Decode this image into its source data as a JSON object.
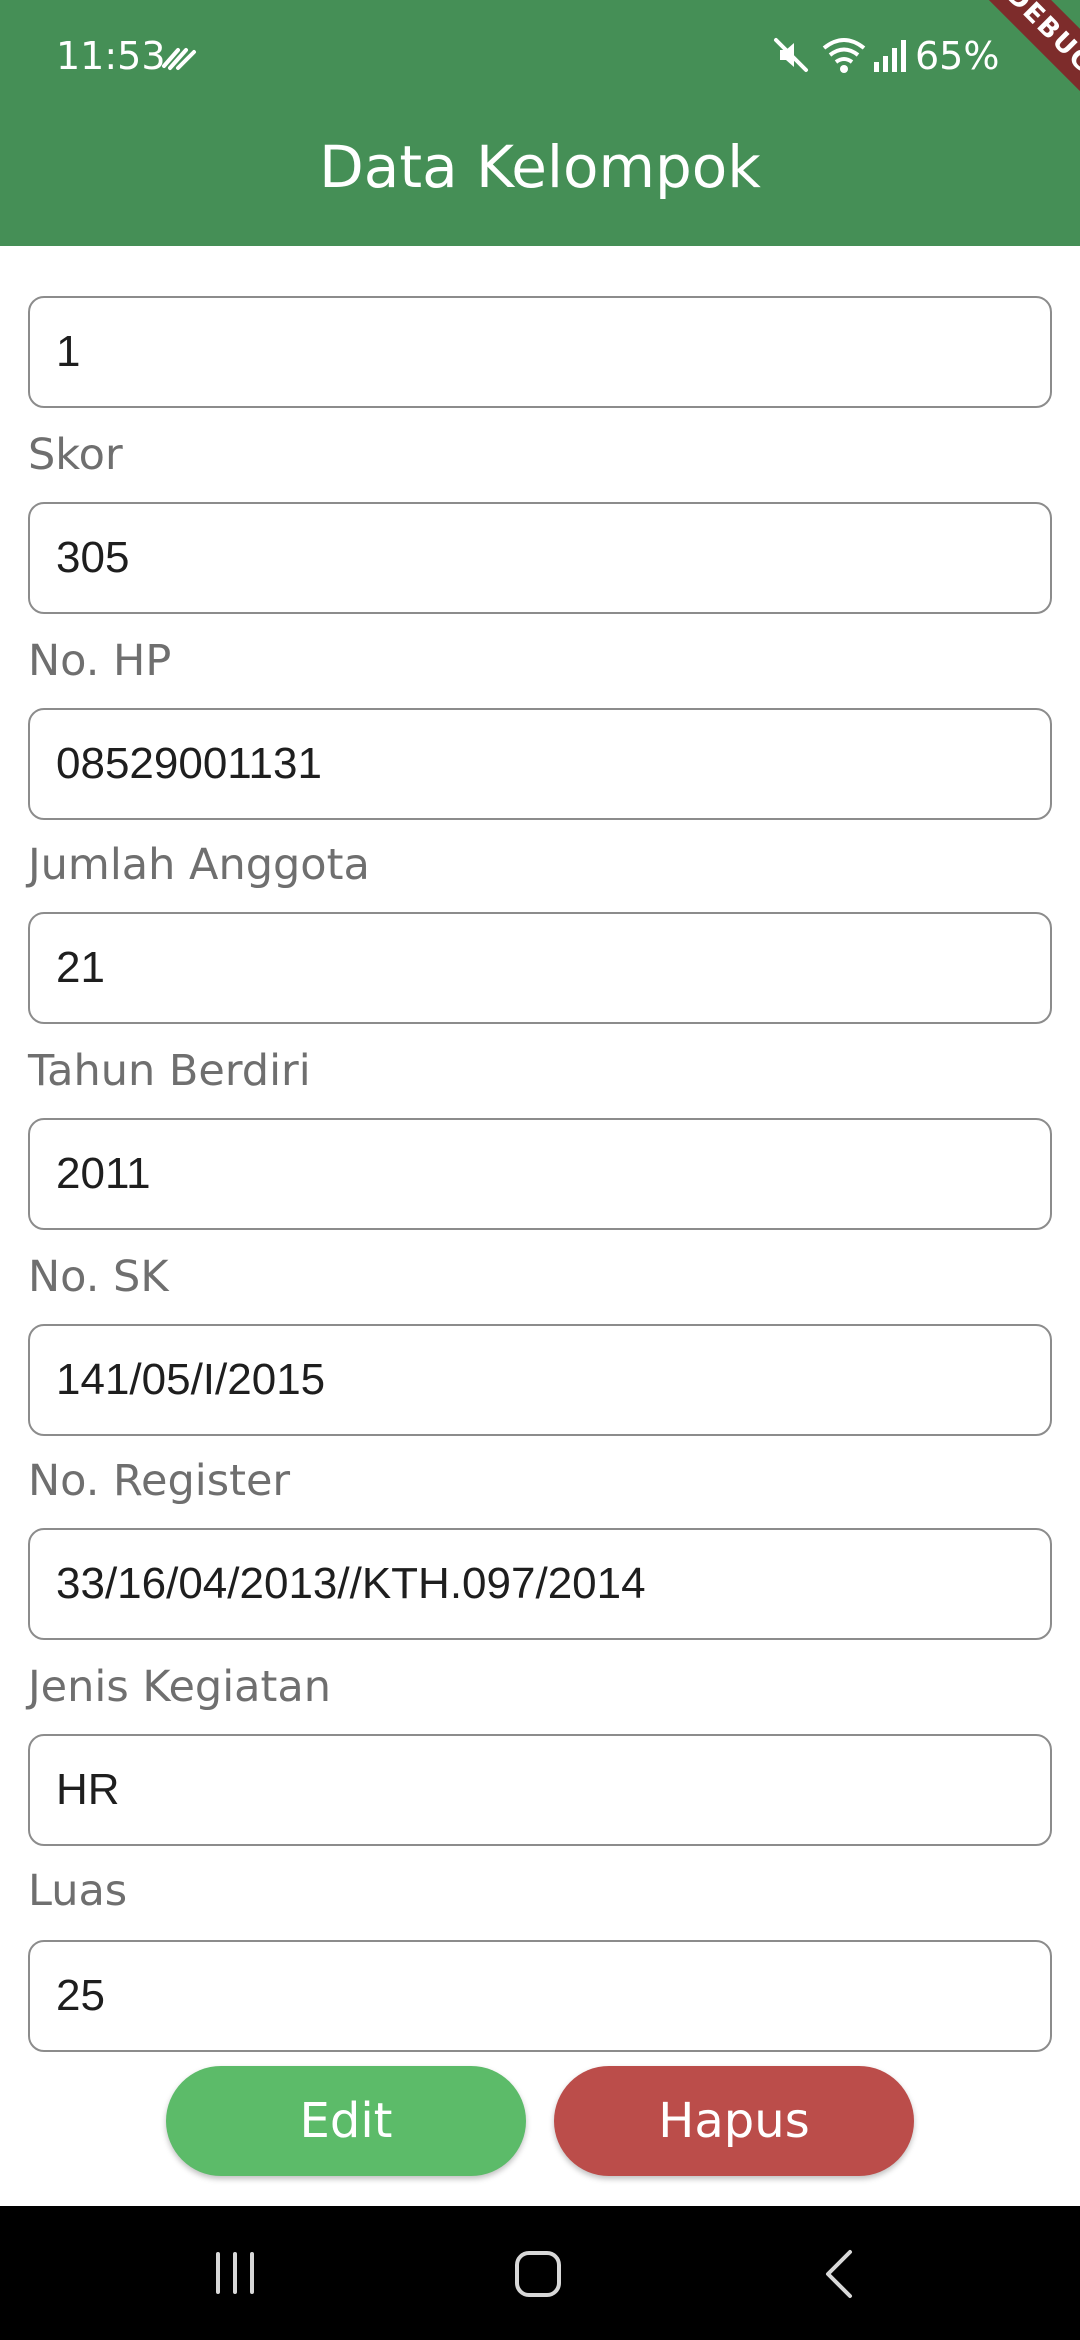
{
  "status_bar": {
    "time": "11:53",
    "battery": "65%",
    "icons": [
      "signal-glyph-icon",
      "mute-icon",
      "wifi-icon",
      "cellular-icon"
    ]
  },
  "app_bar": {
    "title": "Data Kelompok",
    "debug_banner": "DEBUG",
    "color": "#458f56"
  },
  "form": {
    "fields": [
      {
        "label": "",
        "value": "1"
      },
      {
        "label": "Skor",
        "value": "305"
      },
      {
        "label": "No. HP",
        "value": "08529001131"
      },
      {
        "label": "Jumlah Anggota",
        "value": "21"
      },
      {
        "label": "Tahun Berdiri",
        "value": "2011"
      },
      {
        "label": "No. SK",
        "value": "141/05/I/2015"
      },
      {
        "label": "No. Register",
        "value": "33/16/04/2013//KTH.097/2014"
      },
      {
        "label": "Jenis Kegiatan",
        "value": "HR"
      },
      {
        "label": "Luas",
        "value": "25"
      }
    ]
  },
  "actions": {
    "edit_label": "Edit",
    "hapus_label": "Hapus",
    "edit_color": "#5cbb69",
    "hapus_color": "#bb4d4a"
  },
  "nav_bar": {
    "icons": [
      "recent-apps-icon",
      "home-icon",
      "back-icon"
    ]
  }
}
